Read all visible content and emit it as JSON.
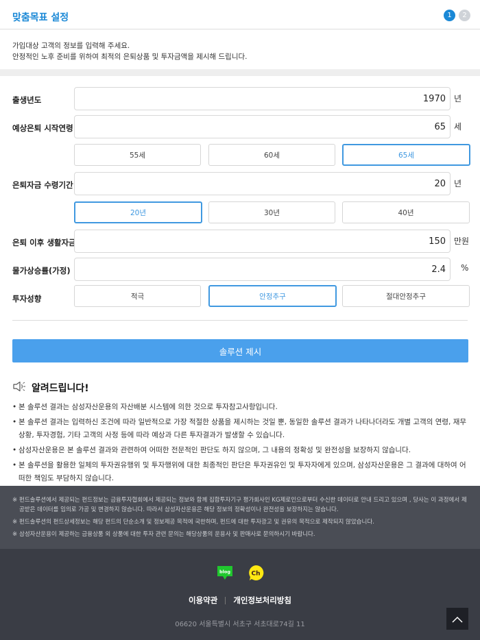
{
  "header": {
    "title": "맞춤목표 설정",
    "steps": [
      "1",
      "2"
    ]
  },
  "intro": {
    "line1": "가입대상 고객의 정보를 입력해 주세요.",
    "line2": "안정적인 노후 준비를 위하여 최적의 은퇴상품 및 투자금액을 제시해 드립니다."
  },
  "form": {
    "birth_year": {
      "label": "출생년도",
      "value": "1970",
      "unit": "년"
    },
    "retire_age": {
      "label": "예상은퇴 시작연령",
      "value": "65",
      "unit": "세",
      "options": [
        "55세",
        "60세",
        "65세"
      ],
      "selected": "65세"
    },
    "payout_period": {
      "label": "은퇴자금 수령기간",
      "value": "20",
      "unit": "년",
      "options": [
        "20년",
        "30년",
        "40년"
      ],
      "selected": "20년"
    },
    "living_cost": {
      "label": "은퇴 이후 생활자금",
      "value": "150",
      "unit": "만원"
    },
    "inflation": {
      "label": "물가상승률(가정)",
      "value": "2.4",
      "unit": "%"
    },
    "risk": {
      "label": "투자성향",
      "options": [
        "적극",
        "안정추구",
        "절대안정추구"
      ],
      "selected": "안정추구"
    },
    "submit_label": "솔루션 제시"
  },
  "notice": {
    "title": "알려드립니다!",
    "items": [
      "본 솔루션 결과는 삼성자산운용의 자산배분 시스템에 의한 것으로 투자참고사항입니다.",
      "본 솔루션 결과는 입력하신 조건에 따라 일반적으로 가장 적절한 상품을 제시하는 것일 뿐, 동일한 솔루션 결과가 나타나더라도 개별 고객의 연령, 재무상황, 투자경험, 기타 고객의 사정 등에 따라 예상과 다른 투자결과가 발생할 수 있습니다.",
      "삼성자산운용은 본 솔루션 결과와 관련하여 어떠한 전문적인 판단도 하지 않으며, 그 내용의 정확성 및 완전성을 보장하지 않습니다.",
      "본 솔루션을 활용한 일체의 투자권유행위 및 투자행위에 대한 최종적인 판단은 투자권유인 및 투자자에게 있으며, 삼성자산운용은 그 결과에 대하여 어떠한 책임도 부담하지 않습니다."
    ]
  },
  "disclaimer": {
    "mark": "※",
    "items": [
      "펀드솔루션에서 제공되는 펀드정보는 금융투자협회에서 제공되는 정보와 함께 집합투자기구 평가회사인 KG제로인으로부터 수신한 데이터로 안내 드리고 있으며 , 당사는 이 과정에서 제공받은 데이터를 임의로 가공 및 변경하지 않습니다. 따라서 삼성자산운용은 해당 정보의 정확성이나 완전성을 보장하지는 않습니다.",
      "펀드솔루션의 펀드상세정보는 해당 펀드의 단순소개 및 정보제공 목적에 국한하며, 펀드에 대한 투자광고 및 권유의 목적으로 제작되지 않았습니다.",
      "삼성자산운용이 제공하는 금융상품 외 상품에 대한 투자 관련 문의는 해당상품의 운용사 및 판매사로 문의하시기 바랍니다."
    ]
  },
  "footer": {
    "sns": {
      "blog_label": "blog",
      "channel_label": "Ch"
    },
    "links": [
      "이용약관",
      "개인정보처리방침"
    ],
    "address": "06620 서울특별시 서초구 서초대로74길 11"
  },
  "colors": {
    "accent": "#1a88d6",
    "selected": "#3f98e0",
    "submit": "#4aa0ec",
    "blog_green": "#20c72e",
    "kakao_yellow": "#ffe812",
    "footer_bg": "#3a3d45",
    "disclaimer_bg": "#4a4d55"
  },
  "icons": [
    "speaker-icon",
    "blog-icon",
    "kakao-channel-icon",
    "chevron-up-icon"
  ]
}
